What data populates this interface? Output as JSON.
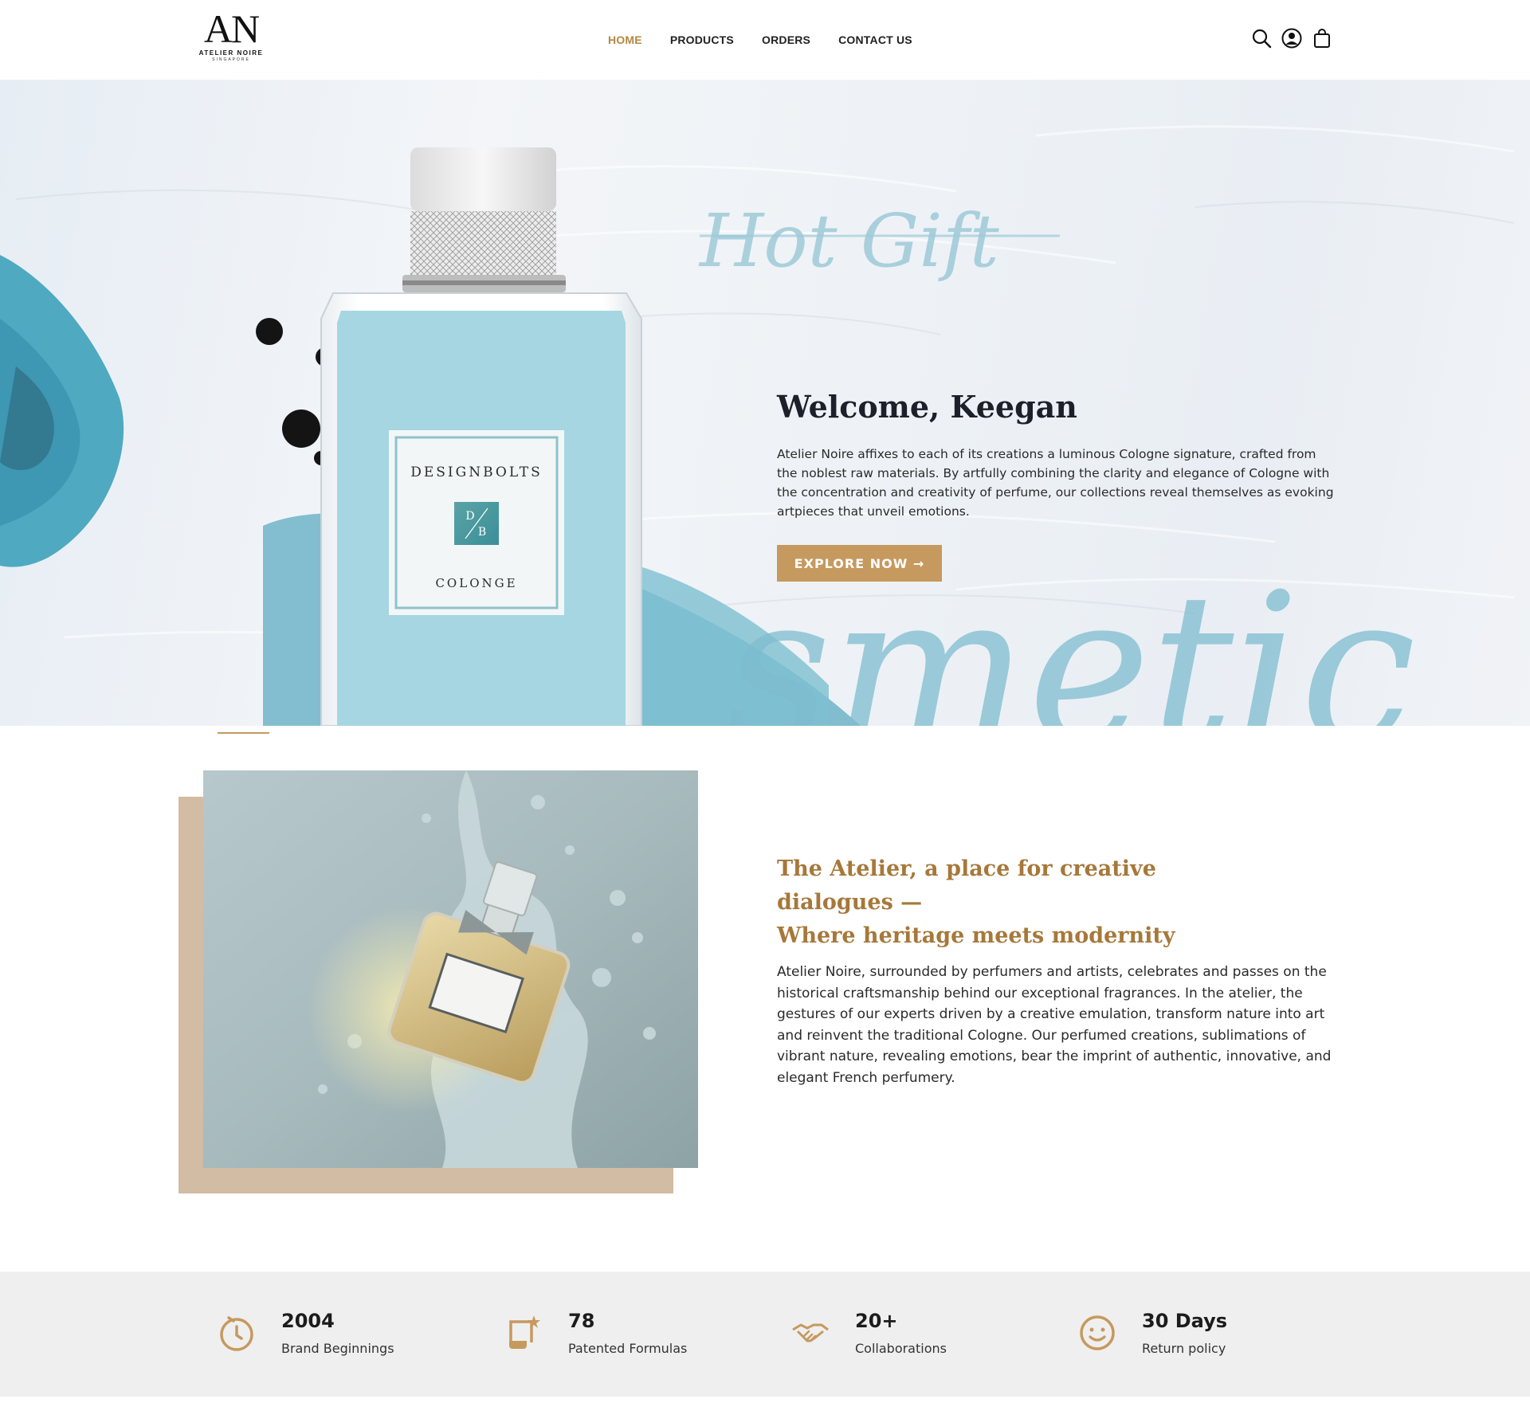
{
  "brand": {
    "logo_mark": "AN",
    "name": "ATELIER NOIRE",
    "location": "SINGAPORE"
  },
  "nav": {
    "items": [
      {
        "label": "HOME",
        "active": true
      },
      {
        "label": "PRODUCTS",
        "active": false
      },
      {
        "label": "ORDERS",
        "active": false
      },
      {
        "label": "CONTACT US",
        "active": false
      }
    ]
  },
  "header_icons": [
    "search-icon",
    "user-icon",
    "shopping-bag-icon"
  ],
  "hero": {
    "script_text": "Hot Gift",
    "background_script": "smetic",
    "bottle_brand": "DESIGNBOLTS",
    "bottle_monogram_top": "D",
    "bottle_monogram_bottom": "B",
    "bottle_type": "COLONGE",
    "welcome": "Welcome, Keegan",
    "text": "Atelier Noire affixes to each of its creations a luminous Cologne signature, crafted from the noblest raw materials. By artfully combining the clarity and elegance of Cologne with the concentration and creativity of perfume, our collections reveal themselves as evoking artpieces that unveil emotions.",
    "button_label": "EXPLORE NOW →"
  },
  "about": {
    "heading_line1": "The Atelier, a place for creative dialogues —",
    "heading_line2": "Where heritage meets modernity",
    "text": "Atelier Noire, surrounded by perfumers and artists, celebrates and passes on the historical craftsmanship behind our exceptional fragrances. In the atelier, the gestures of our experts driven by a creative emulation, transform nature into art and reinvent the traditional Cologne. Our perfumed creations, sublimations of vibrant nature, revealing emotions, bear the imprint of authentic, innovative, and elegant French perfumery."
  },
  "stats": [
    {
      "icon": "clock-icon",
      "value": "2004",
      "label": "Brand Beginnings"
    },
    {
      "icon": "scroll-icon",
      "value": "78",
      "label": "Patented Formulas"
    },
    {
      "icon": "handshake-icon",
      "value": "20+",
      "label": "Collaborations"
    },
    {
      "icon": "smiley-icon",
      "value": "30 Days",
      "label": "Return policy"
    }
  ],
  "colors": {
    "accent": "#c6995e",
    "heading_gold": "#a6783a",
    "card_back": "#d2bca3",
    "stats_bg": "#efefef",
    "hero_blue": "#6fb4c8"
  }
}
